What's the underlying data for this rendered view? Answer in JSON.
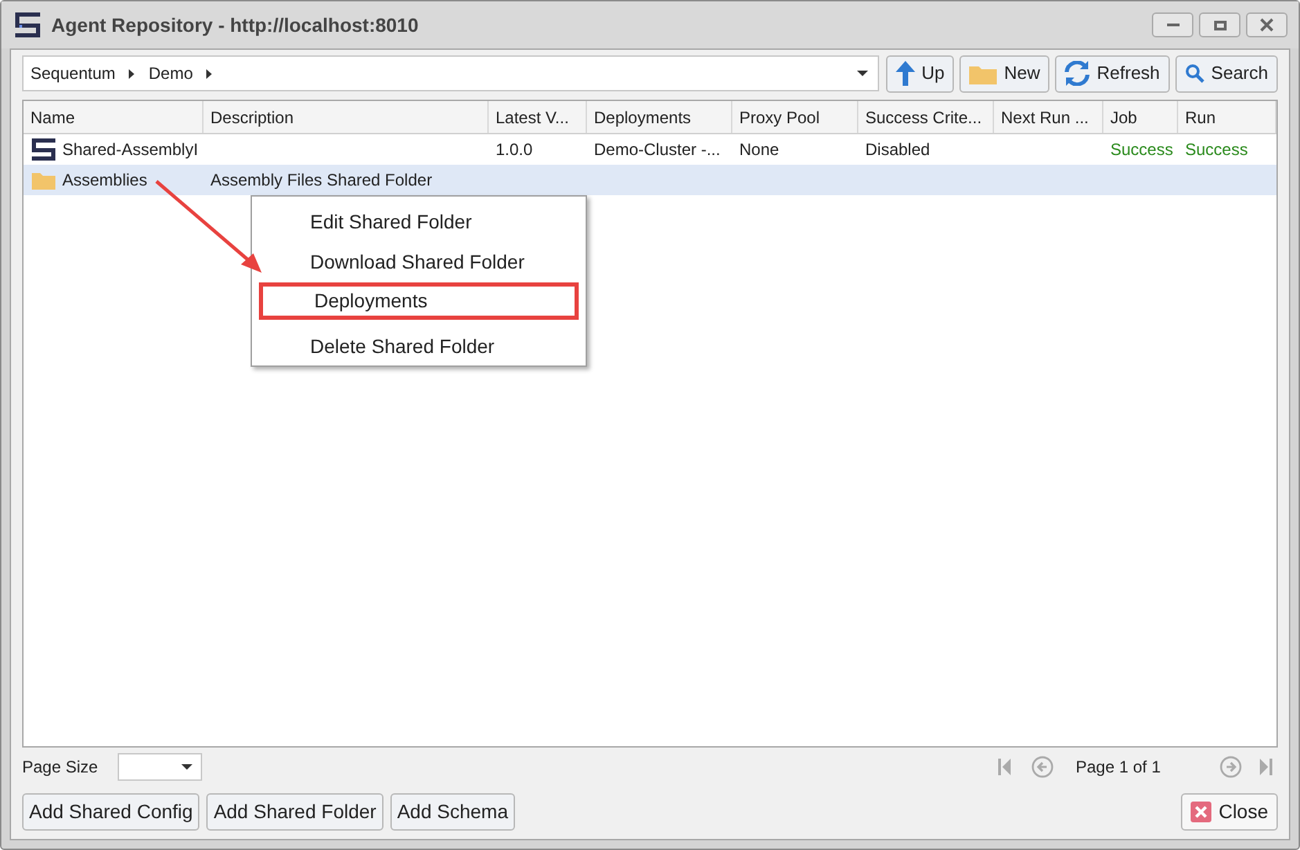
{
  "window": {
    "title": "Agent Repository - http://localhost:8010"
  },
  "breadcrumb": [
    "Sequentum",
    "Demo"
  ],
  "toolbar": [
    {
      "label": "Up",
      "kind": "up"
    },
    {
      "label": "New",
      "kind": "new"
    },
    {
      "label": "Refresh",
      "kind": "refresh"
    },
    {
      "label": "Search",
      "kind": "search"
    }
  ],
  "table": {
    "columns": [
      "Name",
      "Description",
      "Latest V...",
      "Deployments",
      "Proxy Pool",
      "Success Crite...",
      "Next Run ...",
      "Job",
      "Run"
    ],
    "rows": [
      {
        "kind": "agent",
        "selected": false,
        "cells": [
          "Shared-AssemblyI",
          "",
          "1.0.0",
          "Demo-Cluster -...",
          "None",
          "Disabled",
          "",
          "Success",
          "Success"
        ]
      },
      {
        "kind": "folder",
        "selected": true,
        "cells": [
          "Assemblies",
          "Assembly Files Shared Folder",
          "",
          "",
          "",
          "",
          "",
          "",
          ""
        ]
      }
    ]
  },
  "context_menu": [
    {
      "label": "Edit Shared Folder",
      "highlighted": false
    },
    {
      "label": "Download Shared Folder",
      "highlighted": false
    },
    {
      "label": "Deployments",
      "highlighted": true
    },
    {
      "label": "Delete Shared Folder",
      "highlighted": false
    }
  ],
  "pager": {
    "page_size_label": "Page Size",
    "page_text": "Page 1 of 1"
  },
  "buttons": [
    "Add Shared Config",
    "Add Shared Folder",
    "Add Schema"
  ],
  "close_button": "Close"
}
